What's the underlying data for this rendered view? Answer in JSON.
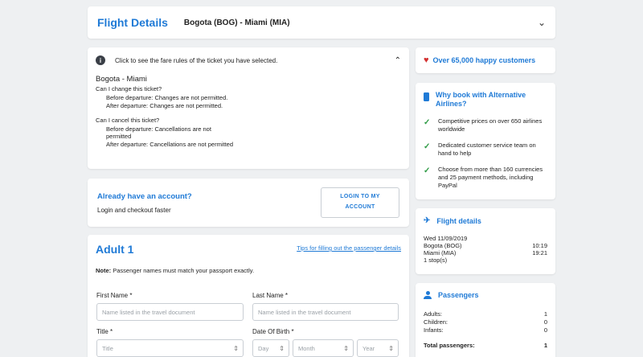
{
  "header": {
    "title": "Flight Details",
    "route": "Bogota (BOG) - Miami (MIA)",
    "expand_icon": "chevron-down-icon"
  },
  "fare_rules": {
    "intro": "Click to see the fare rules of the ticket you have selected.",
    "route": "Bogota - Miami",
    "change_question": "Can I change this ticket?",
    "change_before": "Before departure: Changes are not permitted.",
    "change_after": "After departure: Changes are not permitted.",
    "cancel_question": "Can I cancel this ticket?",
    "cancel_before_1": "Before departure: Cancellations are not",
    "cancel_before_2": "permitted",
    "cancel_after": "After departure: Cancellations are not permitted"
  },
  "account": {
    "heading": "Already have an account?",
    "subtext": "Login and checkout faster",
    "login_line1": "LOGIN TO MY",
    "login_line2": "ACCOUNT"
  },
  "passenger_form": {
    "title": "Adult 1",
    "tips_link": "Tips for filling out the passenger details",
    "note_label": "Note:",
    "note_text": " Passenger names must match your passport exactly.",
    "first_name_label": "First Name *",
    "first_name_placeholder": "Name listed in the travel document",
    "last_name_label": "Last Name *",
    "last_name_placeholder": "Name listed in the travel document",
    "title_label": "Title *",
    "title_value": "Title",
    "dob_label": "Date Of Birth *",
    "dob_day": "Day",
    "dob_month": "Month",
    "dob_year": "Year"
  },
  "sidebar": {
    "happy_customers": "Over 65,000 happy customers",
    "why_heading": "Why book with Alternative Airlines?",
    "why_items": [
      "Competitive prices on over 650 airlines worldwide",
      "Dedicated customer service team on hand to help",
      "Choose from more than 160 currencies and 25 payment methods, including PayPal"
    ],
    "flight_heading": "Flight details",
    "flight_date": "Wed 11/09/2019",
    "origin": "Bogota (BOG)",
    "depart_time": "10:19",
    "destination": "Miami (MIA)",
    "arrive_time": "19:21",
    "stops": "1 stop(s)",
    "passengers_heading": "Passengers",
    "adults_label": "Adults:",
    "adults_value": "1",
    "children_label": "Children:",
    "children_value": "0",
    "infants_label": "Infants:",
    "infants_value": "0",
    "total_label": "Total passengers:",
    "total_value": "1"
  },
  "colors": {
    "accent": "#1f7ad6",
    "heart": "#d32f2f",
    "check": "#2e9b45",
    "background": "#eef0f2"
  }
}
